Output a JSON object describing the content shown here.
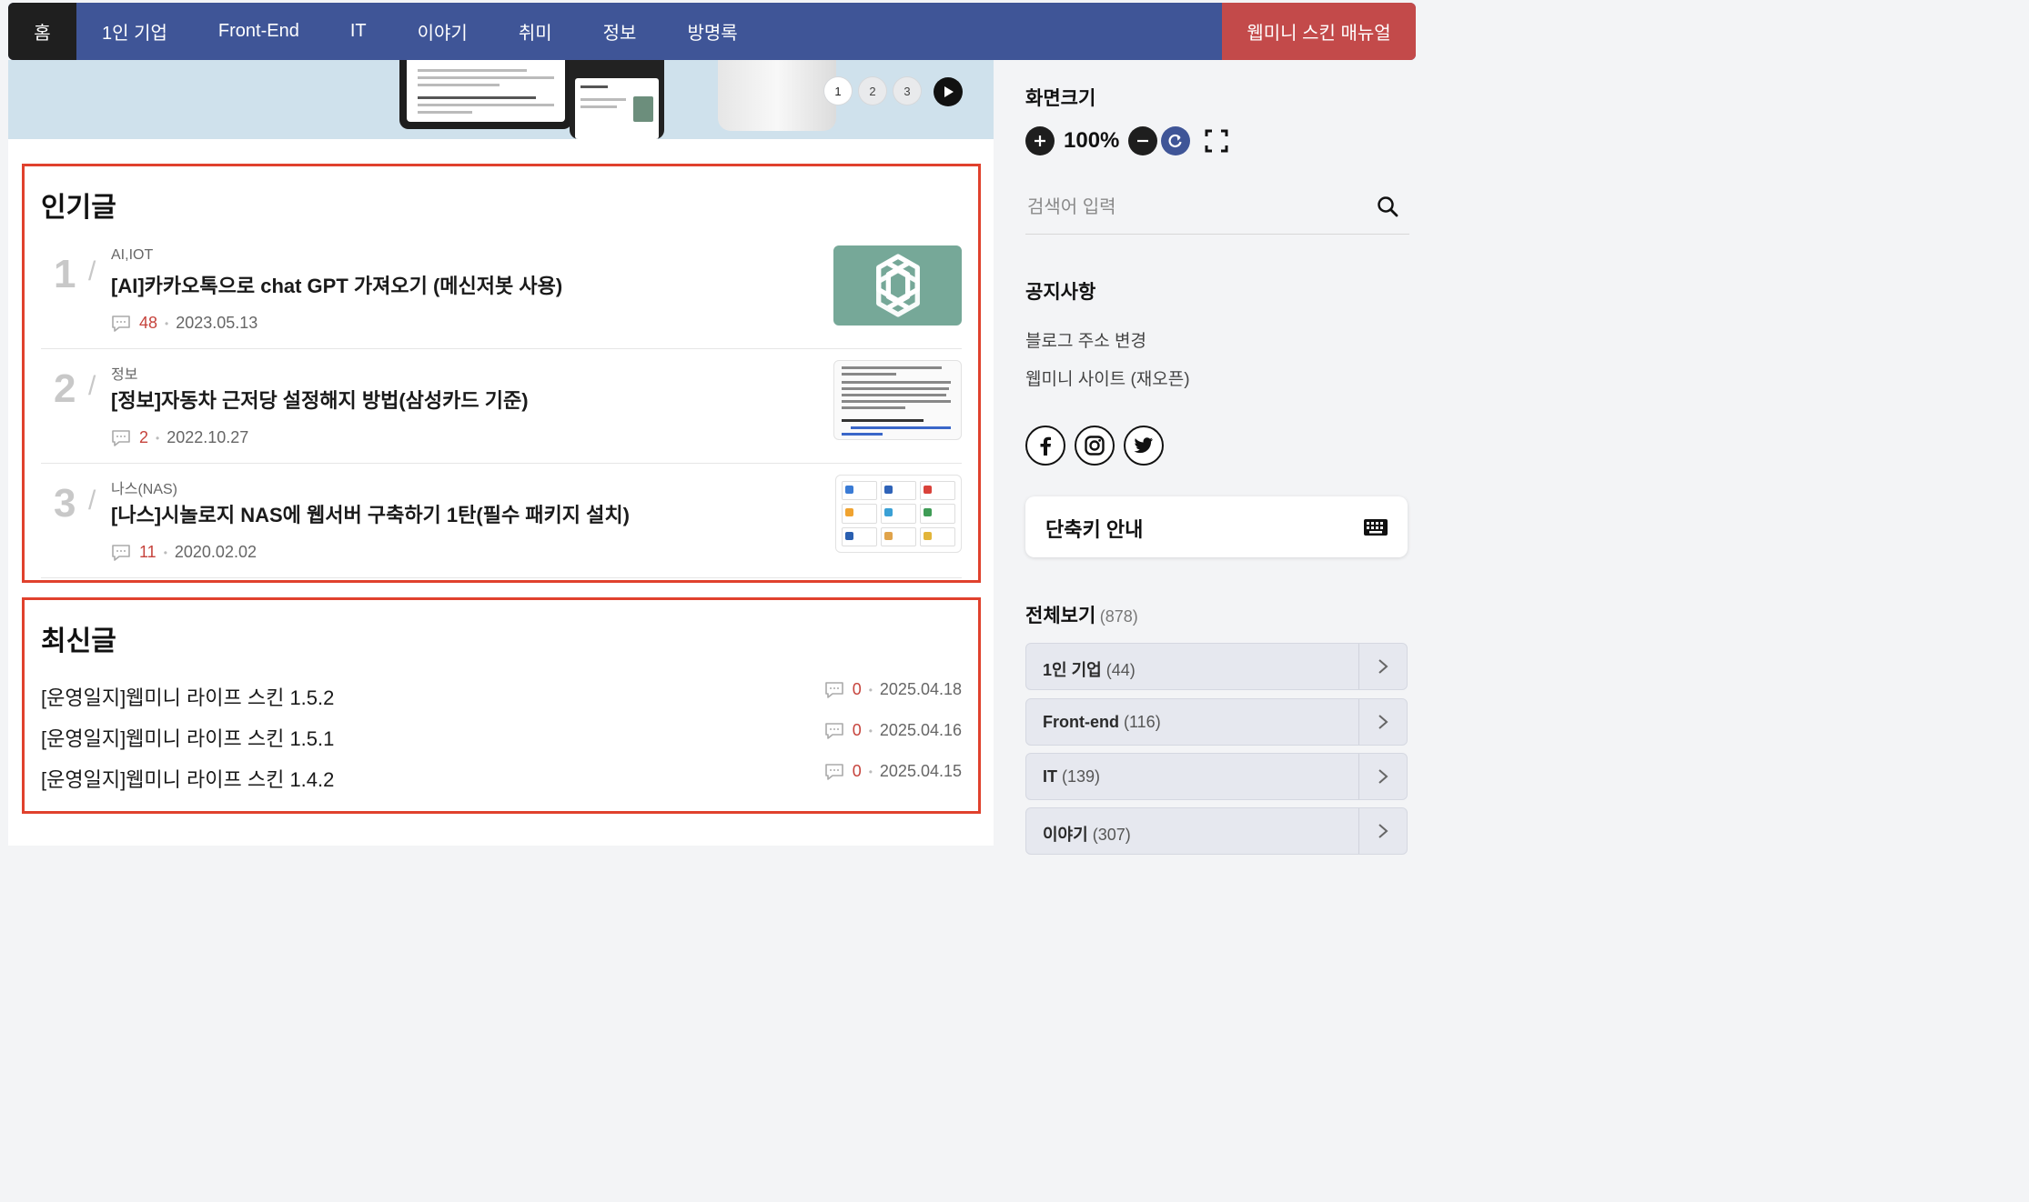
{
  "nav": {
    "home": "홈",
    "items": [
      "1인 기업",
      "Front-End",
      "IT",
      "이야기",
      "취미",
      "정보",
      "방명록"
    ],
    "manual": "웹미니 스킨 매뉴얼"
  },
  "banner": {
    "pages": [
      "1",
      "2",
      "3"
    ],
    "active_page": "1"
  },
  "popular": {
    "title": "인기글",
    "items": [
      {
        "rank": "1",
        "category": "AI,IOT",
        "title": "[AI]카카오톡으로 chat GPT 가져오기 (메신저봇 사용)",
        "comments": "48",
        "date": "2023.05.13",
        "thumb_icon": "openai-logo-icon"
      },
      {
        "rank": "2",
        "category": "정보",
        "title": "[정보]자동차 근저당 설정해지 방법(삼성카드 기준)",
        "comments": "2",
        "date": "2022.10.27",
        "thumb_icon": "document-thumbnail"
      },
      {
        "rank": "3",
        "category": "나스(NAS)",
        "title": "[나스]시놀로지 NAS에 웹서버 구축하기 1탄(필수 패키지 설치)",
        "comments": "11",
        "date": "2020.02.02",
        "thumb_icon": "package-grid-thumbnail"
      }
    ]
  },
  "recent": {
    "title": "최신글",
    "items": [
      {
        "title": "[운영일지]웹미니 라이프 스킨 1.5.2",
        "comments": "0",
        "date": "2025.04.18"
      },
      {
        "title": "[운영일지]웹미니 라이프 스킨 1.5.1",
        "comments": "0",
        "date": "2025.04.16"
      },
      {
        "title": "[운영일지]웹미니 라이프 스킨 1.4.2",
        "comments": "0",
        "date": "2025.04.15"
      }
    ]
  },
  "sidebar": {
    "screen_size_title": "화면크기",
    "zoom_value": "100%",
    "search_placeholder": "검색어 입력",
    "notice_title": "공지사항",
    "notices": [
      "블로그 주소 변경",
      "웹미니 사이트 (재오픈)"
    ],
    "social": [
      "facebook-icon",
      "instagram-icon",
      "twitter-icon"
    ],
    "shortcut_label": "단축키 안내",
    "all_label": "전체보기",
    "all_count": "(878)",
    "categories": [
      {
        "name": "1인 기업",
        "count": "(44)"
      },
      {
        "name": "Front-end",
        "count": "(116)"
      },
      {
        "name": "IT",
        "count": "(139)"
      },
      {
        "name": "이야기",
        "count": "(307)"
      }
    ]
  },
  "colors": {
    "nav_bg": "#3f5597",
    "nav_home_bg": "#1f1f1f",
    "manual_bg": "#c34a4a",
    "highlight_border": "#e0412d",
    "comment_count": "#c6433c"
  }
}
